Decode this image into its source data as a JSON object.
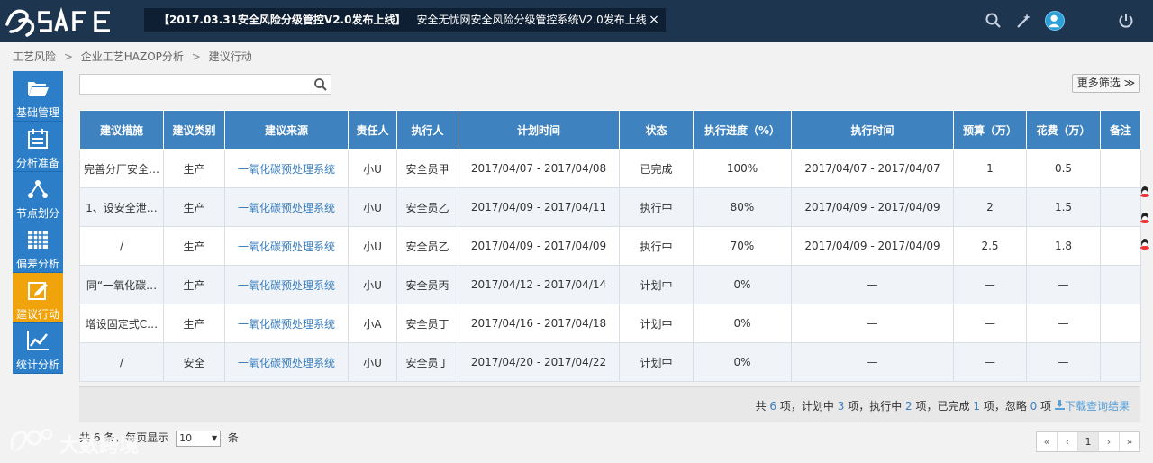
{
  "app": {
    "logo_text": "JSAFE",
    "announcement_highlight": "【2017.03.31安全风险分级管控V2.0发布上线】",
    "announcement_text": "安全无忧网安全风险分级管控系统V2.0发布上线",
    "close_glyph": "×"
  },
  "breadcrumb": {
    "items": [
      "工艺风险",
      "企业工艺HAZOP分析",
      "建议行动"
    ],
    "separator": ">"
  },
  "sidebar": {
    "items": [
      {
        "label": "基础管理",
        "icon": "folder-icon"
      },
      {
        "label": "分析准备",
        "icon": "calendar-icon"
      },
      {
        "label": "节点划分",
        "icon": "nodes-icon"
      },
      {
        "label": "偏差分析",
        "icon": "grid-icon"
      },
      {
        "label": "建议行动",
        "icon": "edit-icon",
        "active": true
      },
      {
        "label": "统计分析",
        "icon": "line-chart-icon"
      }
    ]
  },
  "search": {
    "value": "",
    "placeholder": ""
  },
  "more_filter": {
    "label": "更多筛选 ≫"
  },
  "table": {
    "headers": [
      "建议措施",
      "建议类别",
      "建议来源",
      "责任人",
      "执行人",
      "计划时间",
      "状态",
      "执行进度（%）",
      "执行时间",
      "预算（万）",
      "花费（万）",
      "备注"
    ],
    "rows": [
      [
        "完善分厂安全…",
        "生产",
        "一氧化碳预处理系统",
        "小U",
        "安全员甲",
        "2017/04/07 - 2017/04/08",
        "已完成",
        "100%",
        "2017/04/07 - 2017/04/07",
        "1",
        "0.5",
        ""
      ],
      [
        "1、设安全泄…",
        "生产",
        "一氧化碳预处理系统",
        "小U",
        "安全员乙",
        "2017/04/09 - 2017/04/11",
        "执行中",
        "80%",
        "2017/04/09 - 2017/04/09",
        "2",
        "1.5",
        ""
      ],
      [
        "/",
        "生产",
        "一氧化碳预处理系统",
        "小U",
        "安全员乙",
        "2017/04/09 - 2017/04/09",
        "执行中",
        "70%",
        "2017/04/09 - 2017/04/09",
        "2.5",
        "1.8",
        ""
      ],
      [
        "同“一氧化碳…",
        "生产",
        "一氧化碳预处理系统",
        "小U",
        "安全员丙",
        "2017/04/12 - 2017/04/14",
        "计划中",
        "0%",
        "—",
        "—",
        "—",
        ""
      ],
      [
        "增设固定式C…",
        "生产",
        "一氧化碳预处理系统",
        "小A",
        "安全员丁",
        "2017/04/16 - 2017/04/18",
        "计划中",
        "0%",
        "—",
        "—",
        "—",
        ""
      ],
      [
        "/",
        "安全",
        "一氧化碳预处理系统",
        "小U",
        "安全员丁",
        "2017/04/20 - 2017/04/22",
        "计划中",
        "0%",
        "—",
        "—",
        "—",
        ""
      ]
    ]
  },
  "summary": {
    "prefix": "共",
    "total": "6",
    "t1": "项，计划中",
    "planned": "3",
    "t2": "项，执行中",
    "executing": "2",
    "t3": "项，已完成",
    "completed": "1",
    "t4": "项，忽略",
    "ignored": "0",
    "t5": "项",
    "download": "下载查询结果"
  },
  "footer": {
    "info_prefix": "共 6 条，每页显示",
    "page_size": "10",
    "info_suffix": "条",
    "pages": [
      "«",
      "‹",
      "1",
      "›",
      "»"
    ],
    "current_page": "1"
  },
  "watermark": {
    "text": "大数跨境"
  },
  "colors": {
    "topbar": "#1e3550",
    "nav": "#2b7ec7",
    "nav_active": "#f0a30a",
    "table_header": "#3e83bf",
    "link": "#3a7fc0"
  }
}
